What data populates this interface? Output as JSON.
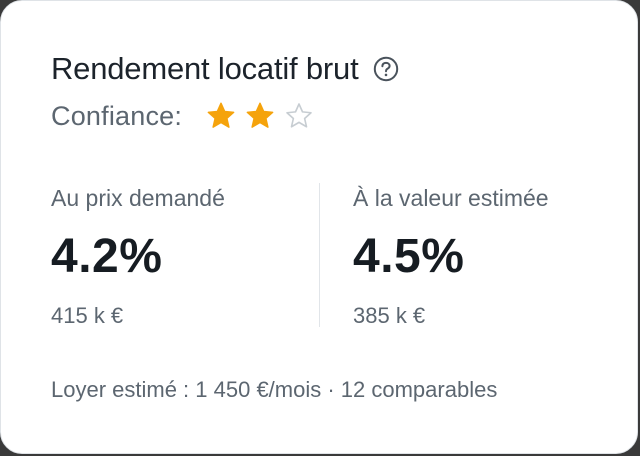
{
  "card": {
    "title": "Rendement locatif brut",
    "help_icon": "question-circle-icon",
    "confidence": {
      "label": "Confiance:",
      "rating": 2,
      "max": 5,
      "stars_shown": 3,
      "filled_color": "#f5a30c",
      "empty_color": "#c7cdd2"
    },
    "asking_price": {
      "label": "Au prix demandé",
      "value": "4.2%",
      "price": "415 k €"
    },
    "estimated_value": {
      "label": "À la valeur estimée",
      "value": "4.5%",
      "price": "385 k €"
    },
    "footer": "Loyer estimé : 1 450 €/mois · 12 comparables"
  }
}
